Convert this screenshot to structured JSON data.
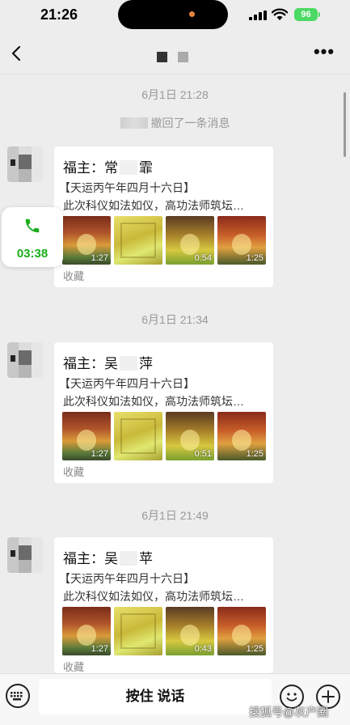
{
  "status_bar": {
    "time": "21:26",
    "battery": "96"
  },
  "nav": {
    "back_icon": "chevron-left-icon",
    "more_label": "•••"
  },
  "system_message": {
    "timestamp": "6月1日 21:28",
    "text": "撤回了一条消息"
  },
  "messages": [
    {
      "timestamp": "6月1日 21:28",
      "title_prefix": "福主：常",
      "title_suffix": "霏",
      "line1": "【天运丙午年四月十六日】",
      "line2": "此次科仪如法如仪，高功法师筑坛…",
      "videos": [
        {
          "duration": "1:27"
        },
        {
          "duration": ""
        },
        {
          "duration": "0:54"
        },
        {
          "duration": "1:25"
        }
      ],
      "footer": "收藏"
    },
    {
      "timestamp": "6月1日 21:34",
      "title_prefix": "福主：吴",
      "title_suffix": "萍",
      "line1": "【天运丙午年四月十六日】",
      "line2": "此次科仪如法如仪，高功法师筑坛…",
      "videos": [
        {
          "duration": "1:27"
        },
        {
          "duration": ""
        },
        {
          "duration": "0:51"
        },
        {
          "duration": "1:25"
        }
      ],
      "footer": "收藏"
    },
    {
      "timestamp": "6月1日 21:49",
      "title_prefix": "福主：吴",
      "title_suffix": "苹",
      "line1": "【天运丙午年四月十六日】",
      "line2": "此次科仪如法如仪，高功法师筑坛…",
      "videos": [
        {
          "duration": "1:27"
        },
        {
          "duration": ""
        },
        {
          "duration": "0:43"
        },
        {
          "duration": "1:25"
        }
      ],
      "footer": "收藏"
    }
  ],
  "call_widget": {
    "duration": "03:38",
    "icon": "phone-icon",
    "color": "#1aad19"
  },
  "input_bar": {
    "talk_label": "按住 说话",
    "voice_icon": "keyboard-icon",
    "emoji_icon": "emoji-icon",
    "plus_icon": "plus-icon"
  },
  "watermark": "搜狐号@灰产圈"
}
